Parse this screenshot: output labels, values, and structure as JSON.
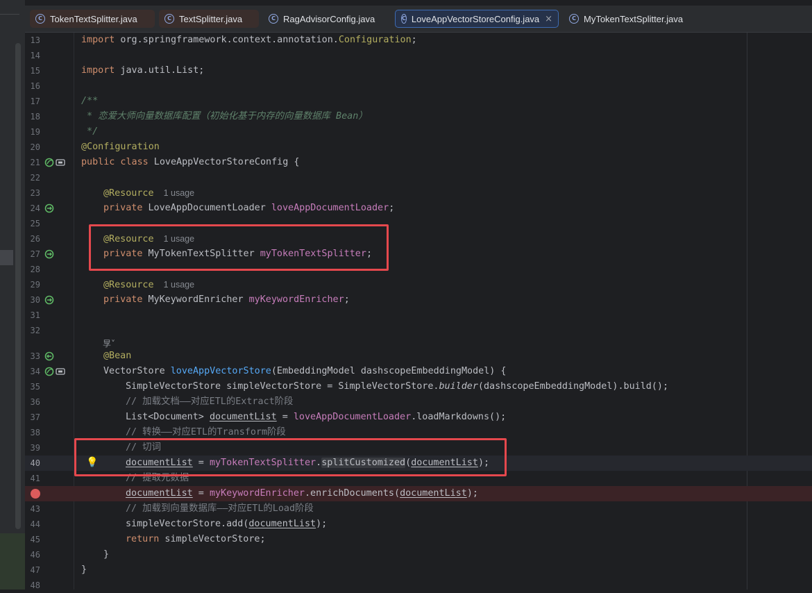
{
  "tabs": [
    {
      "label": "TokenTextSplitter.java",
      "state": "modified"
    },
    {
      "label": "TextSplitter.java",
      "state": "modified"
    },
    {
      "label": "RagAdvisorConfig.java",
      "state": "normal"
    },
    {
      "label": "LoveAppVectorStoreConfig.java",
      "state": "active",
      "close": "×"
    },
    {
      "label": "MyTokenTextSplitter.java",
      "state": "normal"
    }
  ],
  "tab_icon_letter": "C",
  "inlay_hint": "1 usage",
  "ai_marker": "㫗˅",
  "line_numbers": [
    "13",
    "14",
    "15",
    "16",
    "17",
    "18",
    "19",
    "20",
    "21",
    "22",
    "23",
    "24",
    "25",
    "26",
    "27",
    "28",
    "29",
    "30",
    "31",
    "32",
    "",
    "33",
    "34",
    "35",
    "36",
    "37",
    "38",
    "39",
    "40",
    "41",
    "42",
    "43",
    "44",
    "45",
    "46",
    "47",
    "48"
  ],
  "code": {
    "l13": [
      "import",
      " org.springframework.context.annotation.",
      "Configuration",
      ";"
    ],
    "l15": [
      "import",
      " java.util.List;"
    ],
    "l17": "/**",
    "l18": " * 恋爱大师向量数据库配置（初始化基于内存的向量数据库 Bean）",
    "l19": " */",
    "l20": "@Configuration",
    "l21": [
      "public class",
      " LoveAppVectorStoreConfig {"
    ],
    "l23": "@Resource",
    "l24": [
      "private",
      " LoveAppDocumentLoader ",
      "loveAppDocumentLoader",
      ";"
    ],
    "l26": "@Resource",
    "l27": [
      "private",
      " MyTokenTextSplitter ",
      "myTokenTextSplitter",
      ";"
    ],
    "l29": "@Resource",
    "l30": [
      "private",
      " MyKeywordEnricher ",
      "myKeywordEnricher",
      ";"
    ],
    "l33": "@Bean",
    "l34": [
      "VectorStore ",
      "loveAppVectorStore",
      "(EmbeddingModel dashscopeEmbeddingModel) {"
    ],
    "l35": [
      "SimpleVectorStore simpleVectorStore = SimpleVectorStore.",
      "builder",
      "(dashscopeEmbeddingModel).build();"
    ],
    "l36": "// 加载文档——对应ETL的Extract阶段",
    "l37": [
      "List<Document> ",
      "documentList",
      " = ",
      "loveAppDocumentLoader",
      ".loadMarkdowns();"
    ],
    "l38": "// 转换——对应ETL的Transform阶段",
    "l39": "// 切词",
    "l40": [
      "documentList",
      " = ",
      "myTokenTextSplitter",
      ".",
      "splitCustomized",
      "(",
      "documentList",
      ");"
    ],
    "l41": "// 提取元数据",
    "l42": [
      "documentList",
      " = ",
      "myKeywordEnricher",
      ".enrichDocuments(",
      "documentList",
      ");"
    ],
    "l43": "// 加载到向量数据库——对应ETL的Load阶段",
    "l44": [
      "simpleVectorStore.add(",
      "documentList",
      ");"
    ],
    "l45": [
      "return",
      " simpleVectorStore;"
    ],
    "l46": "}",
    "l47": "}"
  },
  "colors": {
    "keyword": "#cf8e6d",
    "annotation": "#b3ae60",
    "field": "#c77dbb",
    "method": "#56a8f5",
    "comment": "#7a7e85",
    "highlight_box": "#e5484d",
    "breakpoint": "#db5c5c"
  }
}
